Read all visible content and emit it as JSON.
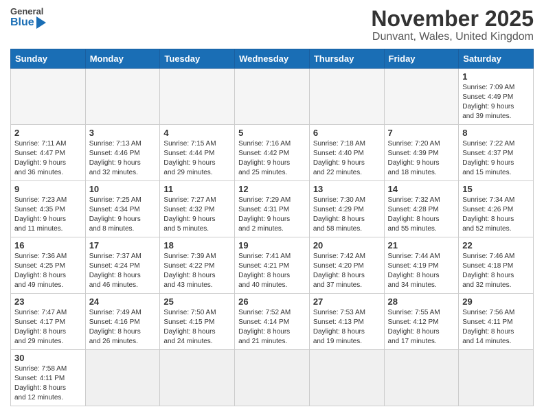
{
  "header": {
    "logo_general": "General",
    "logo_blue": "Blue",
    "month_title": "November 2025",
    "location": "Dunvant, Wales, United Kingdom"
  },
  "weekdays": [
    "Sunday",
    "Monday",
    "Tuesday",
    "Wednesday",
    "Thursday",
    "Friday",
    "Saturday"
  ],
  "weeks": [
    [
      {
        "day": "",
        "info": ""
      },
      {
        "day": "",
        "info": ""
      },
      {
        "day": "",
        "info": ""
      },
      {
        "day": "",
        "info": ""
      },
      {
        "day": "",
        "info": ""
      },
      {
        "day": "",
        "info": ""
      },
      {
        "day": "1",
        "info": "Sunrise: 7:09 AM\nSunset: 4:49 PM\nDaylight: 9 hours\nand 39 minutes."
      }
    ],
    [
      {
        "day": "2",
        "info": "Sunrise: 7:11 AM\nSunset: 4:47 PM\nDaylight: 9 hours\nand 36 minutes."
      },
      {
        "day": "3",
        "info": "Sunrise: 7:13 AM\nSunset: 4:46 PM\nDaylight: 9 hours\nand 32 minutes."
      },
      {
        "day": "4",
        "info": "Sunrise: 7:15 AM\nSunset: 4:44 PM\nDaylight: 9 hours\nand 29 minutes."
      },
      {
        "day": "5",
        "info": "Sunrise: 7:16 AM\nSunset: 4:42 PM\nDaylight: 9 hours\nand 25 minutes."
      },
      {
        "day": "6",
        "info": "Sunrise: 7:18 AM\nSunset: 4:40 PM\nDaylight: 9 hours\nand 22 minutes."
      },
      {
        "day": "7",
        "info": "Sunrise: 7:20 AM\nSunset: 4:39 PM\nDaylight: 9 hours\nand 18 minutes."
      },
      {
        "day": "8",
        "info": "Sunrise: 7:22 AM\nSunset: 4:37 PM\nDaylight: 9 hours\nand 15 minutes."
      }
    ],
    [
      {
        "day": "9",
        "info": "Sunrise: 7:23 AM\nSunset: 4:35 PM\nDaylight: 9 hours\nand 11 minutes."
      },
      {
        "day": "10",
        "info": "Sunrise: 7:25 AM\nSunset: 4:34 PM\nDaylight: 9 hours\nand 8 minutes."
      },
      {
        "day": "11",
        "info": "Sunrise: 7:27 AM\nSunset: 4:32 PM\nDaylight: 9 hours\nand 5 minutes."
      },
      {
        "day": "12",
        "info": "Sunrise: 7:29 AM\nSunset: 4:31 PM\nDaylight: 9 hours\nand 2 minutes."
      },
      {
        "day": "13",
        "info": "Sunrise: 7:30 AM\nSunset: 4:29 PM\nDaylight: 8 hours\nand 58 minutes."
      },
      {
        "day": "14",
        "info": "Sunrise: 7:32 AM\nSunset: 4:28 PM\nDaylight: 8 hours\nand 55 minutes."
      },
      {
        "day": "15",
        "info": "Sunrise: 7:34 AM\nSunset: 4:26 PM\nDaylight: 8 hours\nand 52 minutes."
      }
    ],
    [
      {
        "day": "16",
        "info": "Sunrise: 7:36 AM\nSunset: 4:25 PM\nDaylight: 8 hours\nand 49 minutes."
      },
      {
        "day": "17",
        "info": "Sunrise: 7:37 AM\nSunset: 4:24 PM\nDaylight: 8 hours\nand 46 minutes."
      },
      {
        "day": "18",
        "info": "Sunrise: 7:39 AM\nSunset: 4:22 PM\nDaylight: 8 hours\nand 43 minutes."
      },
      {
        "day": "19",
        "info": "Sunrise: 7:41 AM\nSunset: 4:21 PM\nDaylight: 8 hours\nand 40 minutes."
      },
      {
        "day": "20",
        "info": "Sunrise: 7:42 AM\nSunset: 4:20 PM\nDaylight: 8 hours\nand 37 minutes."
      },
      {
        "day": "21",
        "info": "Sunrise: 7:44 AM\nSunset: 4:19 PM\nDaylight: 8 hours\nand 34 minutes."
      },
      {
        "day": "22",
        "info": "Sunrise: 7:46 AM\nSunset: 4:18 PM\nDaylight: 8 hours\nand 32 minutes."
      }
    ],
    [
      {
        "day": "23",
        "info": "Sunrise: 7:47 AM\nSunset: 4:17 PM\nDaylight: 8 hours\nand 29 minutes."
      },
      {
        "day": "24",
        "info": "Sunrise: 7:49 AM\nSunset: 4:16 PM\nDaylight: 8 hours\nand 26 minutes."
      },
      {
        "day": "25",
        "info": "Sunrise: 7:50 AM\nSunset: 4:15 PM\nDaylight: 8 hours\nand 24 minutes."
      },
      {
        "day": "26",
        "info": "Sunrise: 7:52 AM\nSunset: 4:14 PM\nDaylight: 8 hours\nand 21 minutes."
      },
      {
        "day": "27",
        "info": "Sunrise: 7:53 AM\nSunset: 4:13 PM\nDaylight: 8 hours\nand 19 minutes."
      },
      {
        "day": "28",
        "info": "Sunrise: 7:55 AM\nSunset: 4:12 PM\nDaylight: 8 hours\nand 17 minutes."
      },
      {
        "day": "29",
        "info": "Sunrise: 7:56 AM\nSunset: 4:11 PM\nDaylight: 8 hours\nand 14 minutes."
      }
    ],
    [
      {
        "day": "30",
        "info": "Sunrise: 7:58 AM\nSunset: 4:11 PM\nDaylight: 8 hours\nand 12 minutes."
      },
      {
        "day": "",
        "info": ""
      },
      {
        "day": "",
        "info": ""
      },
      {
        "day": "",
        "info": ""
      },
      {
        "day": "",
        "info": ""
      },
      {
        "day": "",
        "info": ""
      },
      {
        "day": "",
        "info": ""
      }
    ]
  ]
}
